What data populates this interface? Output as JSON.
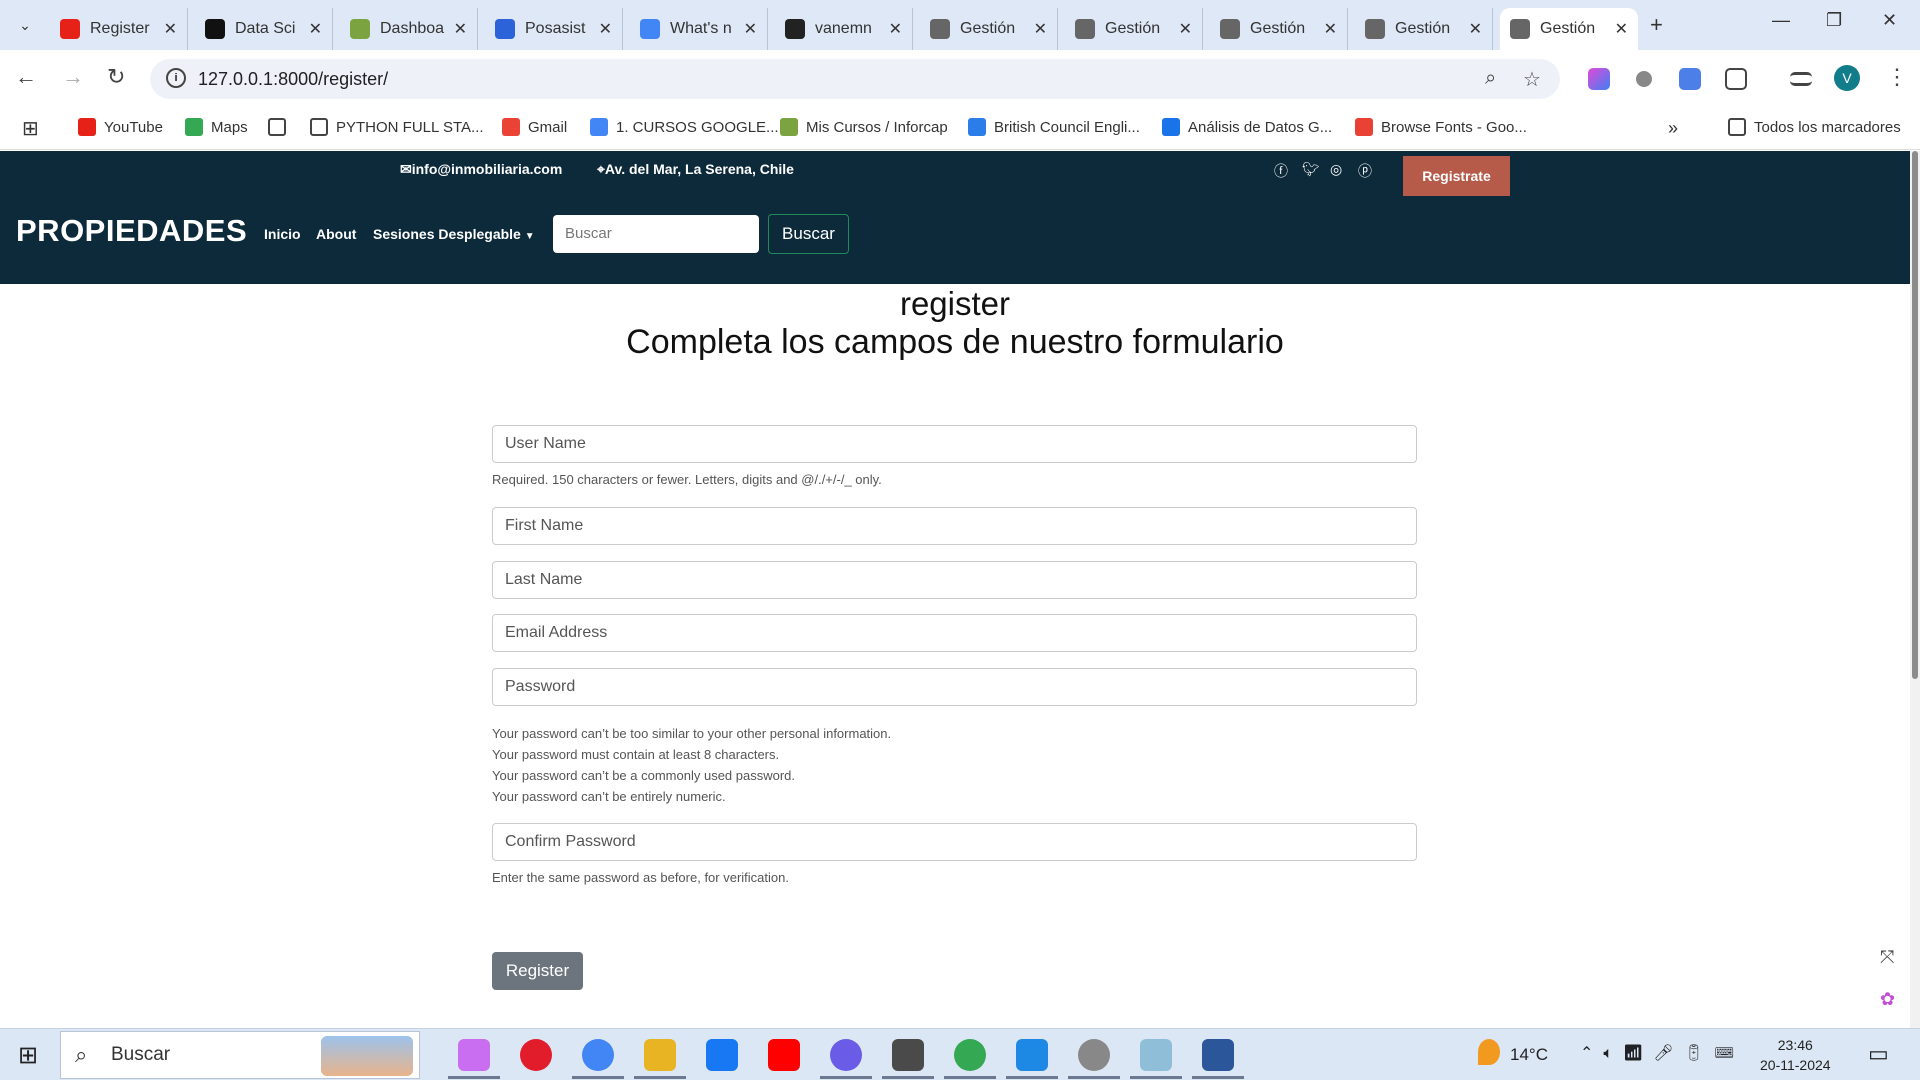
{
  "browser": {
    "tabs": [
      {
        "title": "Register",
        "color": "#e62117"
      },
      {
        "title": "Data Sci",
        "color": "#111"
      },
      {
        "title": "Dashboa",
        "color": "#7ba33f"
      },
      {
        "title": "Posasist",
        "color": "#2d63d8"
      },
      {
        "title": "What's n",
        "color": "#4285f4"
      },
      {
        "title": "vanemn",
        "color": "#222"
      },
      {
        "title": "Gestión",
        "color": "#666"
      },
      {
        "title": "Gestión",
        "color": "#666"
      },
      {
        "title": "Gestión",
        "color": "#666"
      },
      {
        "title": "Gestión",
        "color": "#666"
      },
      {
        "title": "Gestión",
        "color": "#666"
      }
    ],
    "url": "127.0.0.1:8000/register/",
    "profile_initial": "V",
    "bookmarks": [
      "YouTube",
      "Maps",
      "",
      "PYTHON FULL STA...",
      "Gmail",
      "1. CURSOS GOOGLE...",
      "Mis Cursos / Inforcap",
      "British Council Engli...",
      "Análisis de Datos G...",
      "Browse Fonts - Goo..."
    ],
    "all_bookmarks": "Todos los marcadores"
  },
  "site": {
    "email": "info@inmobiliaria.com",
    "address": "Av. del Mar, La Serena, Chile",
    "register_cta": "Registrate",
    "brand": "PROPIEDADES",
    "nav": [
      "Inicio",
      "About",
      "Sesiones Desplegable"
    ],
    "search_placeholder": "Buscar",
    "search_button": "Buscar"
  },
  "form": {
    "title": "register",
    "subtitle": "Completa los campos de nuestro formulario",
    "username_placeholder": "User Name",
    "username_help": "Required. 150 characters or fewer. Letters, digits and @/./+/-/_ only.",
    "first_name_placeholder": "First Name",
    "last_name_placeholder": "Last Name",
    "email_placeholder": "Email Address",
    "password_placeholder": "Password",
    "password_help": [
      "Your password can’t be too similar to your other personal information.",
      "Your password must contain at least 8 characters.",
      "Your password can’t be a commonly used password.",
      "Your password can’t be entirely numeric."
    ],
    "confirm_placeholder": "Confirm Password",
    "confirm_help": "Enter the same password as before, for verification.",
    "submit": "Register"
  },
  "taskbar": {
    "search": "Buscar",
    "temperature": "14°C",
    "time": "23:46",
    "date": "20-11-2024"
  }
}
